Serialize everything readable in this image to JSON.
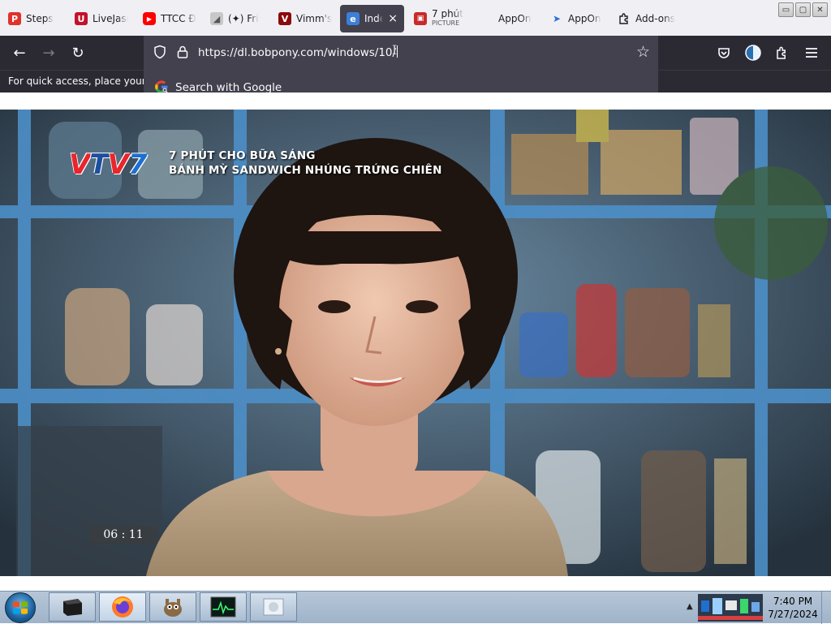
{
  "browser": {
    "tabs": [
      {
        "label": "Steps",
        "favicon_color": "#e0322b",
        "favicon_glyph": "P"
      },
      {
        "label": "LiveJasmin",
        "favicon_color": "#c4122b",
        "favicon_glyph": "U"
      },
      {
        "label": "TTCC Đ",
        "favicon_color": "#ff0000",
        "favicon_glyph": "▶"
      },
      {
        "label": "(✦) Fri",
        "favicon_color": "#b0b0b0",
        "favicon_glyph": "◢"
      },
      {
        "label": "Vimm's",
        "favicon_color": "#8b0a0a",
        "favicon_glyph": "V"
      },
      {
        "label": "Index",
        "favicon_color": "#3c7fd6",
        "favicon_glyph": "e",
        "active": true
      },
      {
        "label": "7 phút",
        "sub_label": "PICTURE",
        "favicon_color": "#c92a2a",
        "favicon_glyph": "▣"
      },
      {
        "label": "AppOn",
        "favicon_color": "",
        "favicon_glyph": ""
      },
      {
        "label": "AppOn",
        "favicon_color": "#2a6fd6",
        "favicon_glyph": "➤"
      },
      {
        "label": "Add-ons",
        "favicon_color": "",
        "favicon_glyph": "puzzle"
      }
    ],
    "active_tab_close": "×",
    "window_buttons": {
      "minimize": "▭",
      "maximize": "▢",
      "close": "✕"
    },
    "nav": {
      "back": "←",
      "forward": "→",
      "reload": "↻"
    },
    "url": "https://dl.bobpony.com/windows/10/",
    "suggestion": "Search with Google",
    "bookmark_hint": "For quick access, place your bookmarks here on the bookmarks toolbar.",
    "toolbar_icons": [
      "shield-icon",
      "lock-icon",
      "star-icon",
      "pocket-icon",
      "account-icon",
      "extensions-icon",
      "menu-icon"
    ]
  },
  "video": {
    "logo": {
      "v1": "V",
      "t": "T",
      "v2": "V",
      "seven": "7"
    },
    "caption_line1": "7 PHÚT CHO BỮA SÁNG",
    "caption_line2": "BÁNH MỲ SANDWICH NHÚNG TRỨNG CHIÊN",
    "timestamp": "06 : 11",
    "colors": {
      "shelf": "#4a8cc4",
      "background": "#2a3a48",
      "skin": "#e2b49a",
      "hair": "#1e1410"
    }
  },
  "taskbar": {
    "buttons": [
      "terminal-app",
      "firefox",
      "gimp",
      "task-manager",
      "generic-window"
    ],
    "clock_time": "7:40 PM",
    "clock_date": "7/27/2024"
  }
}
